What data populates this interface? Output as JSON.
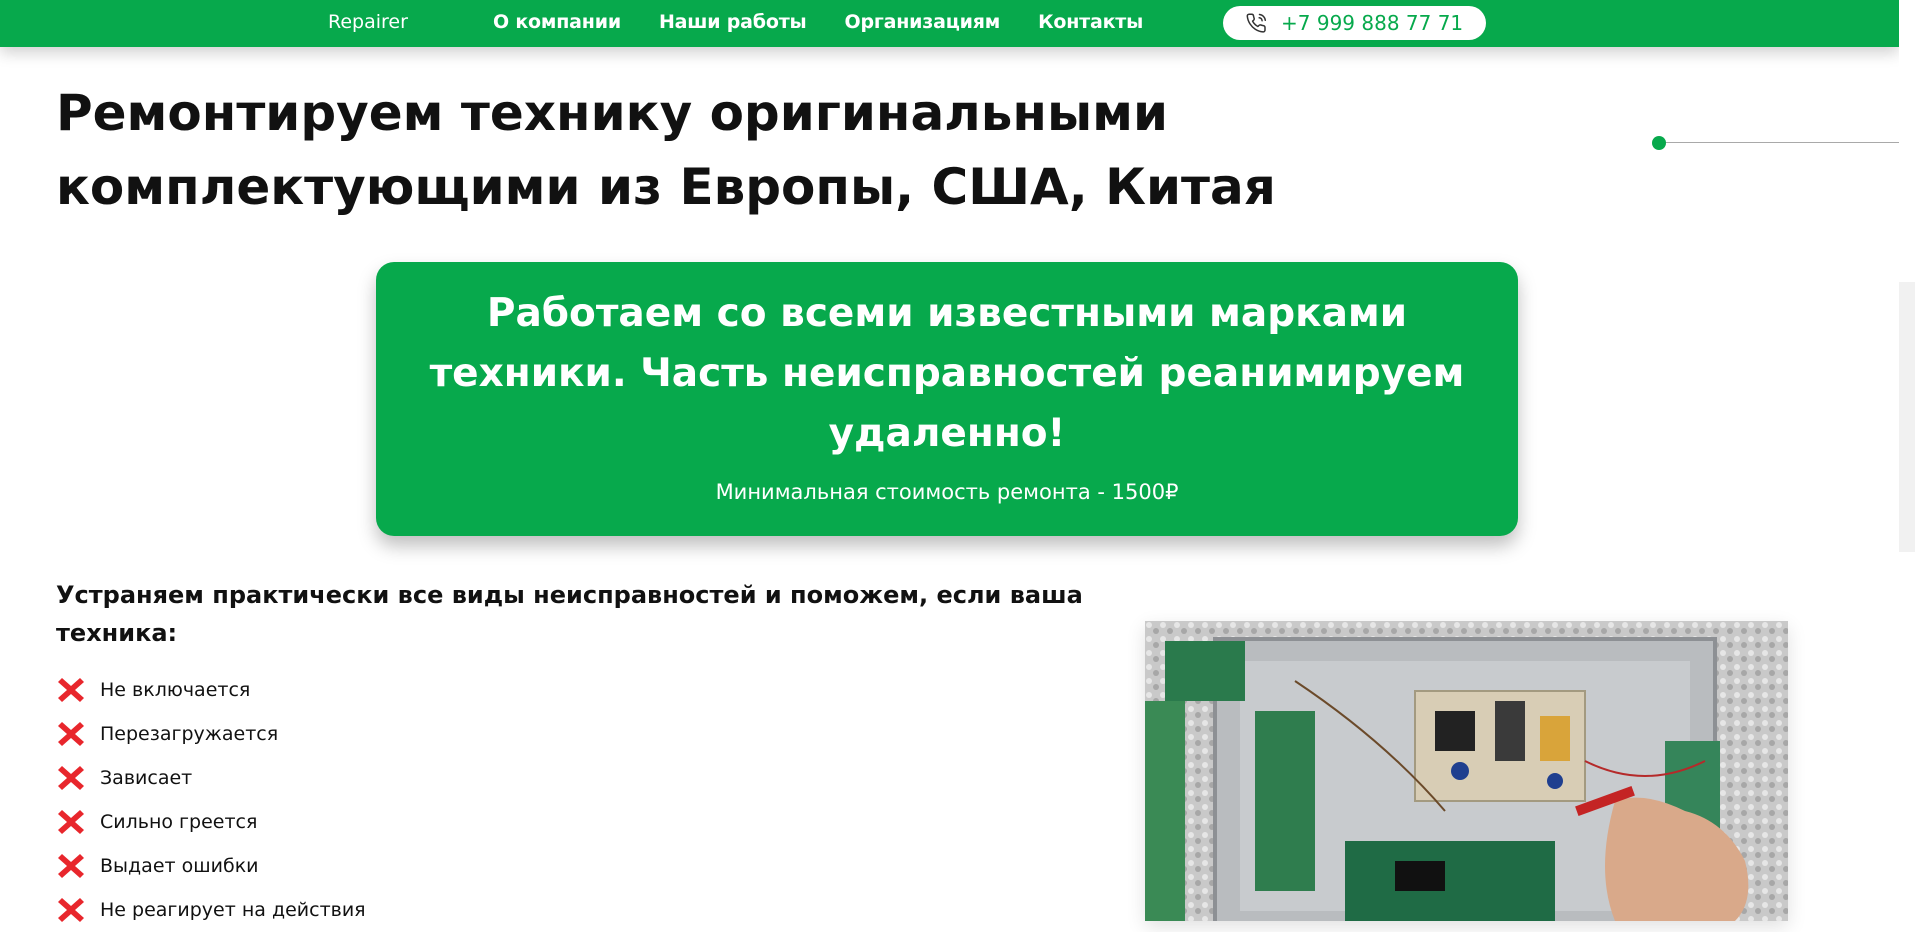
{
  "header": {
    "logo": "Repairer",
    "nav": [
      {
        "label": "О компании"
      },
      {
        "label": "Наши работы"
      },
      {
        "label": "Организациям"
      },
      {
        "label": "Контакты"
      }
    ],
    "phone": "+7 999 888 77 71",
    "phone_icon": "phone-icon"
  },
  "hero": {
    "title": "Ремонтируем технику оригинальными комплектующими из Европы, США, Китая"
  },
  "banner": {
    "title": "Работаем со всеми известными марками техники. Часть неисправностей реанимируем удаленно!",
    "subtitle": "Минимальная стоимость ремонта - 1500₽"
  },
  "faults": {
    "heading": "Устраняем практически все виды неисправностей и поможем, если ваша техника:",
    "icon": "red-x-icon",
    "items": [
      {
        "label": "Не включается"
      },
      {
        "label": "Перезагружается"
      },
      {
        "label": "Зависает"
      },
      {
        "label": "Сильно греется"
      },
      {
        "label": "Выдает ошибки"
      },
      {
        "label": "Не реагирует на действия"
      }
    ]
  },
  "colors": {
    "brand_green": "#07a94c",
    "cross_red": "#e8262c",
    "text": "#111111"
  }
}
